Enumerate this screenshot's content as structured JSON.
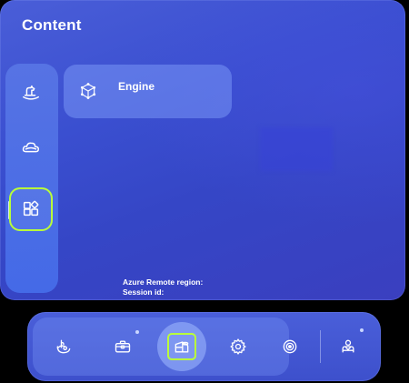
{
  "panel": {
    "title": "Content"
  },
  "rail": {
    "items": [
      {
        "id": "rocking-horse",
        "icon": "rocking-horse-icon",
        "selected": false
      },
      {
        "id": "cloud",
        "icon": "cloud-outline-icon",
        "selected": false
      },
      {
        "id": "app-grid-add",
        "icon": "app-grid-add-icon",
        "selected": true
      }
    ]
  },
  "cards": [
    {
      "label": "Engine",
      "icon": "cube-icon"
    }
  ],
  "info": {
    "region_label": "Azure Remote region:",
    "session_label": "Session id:"
  },
  "toolbar": {
    "items": [
      {
        "id": "mixed-reality",
        "icon": "eye-hand-icon"
      },
      {
        "id": "toolbox",
        "icon": "toolbox-icon",
        "badge": true
      },
      {
        "id": "content",
        "icon": "content-box-icon",
        "active": true
      },
      {
        "id": "settings",
        "icon": "gear-icon"
      },
      {
        "id": "target",
        "icon": "target-icon"
      },
      {
        "id": "assistant",
        "icon": "person-assistant-icon",
        "badge": true
      }
    ]
  },
  "colors": {
    "accent_highlight": "#b9ff3a",
    "panel_blue": "#3a4fd0",
    "text": "#ffffff"
  }
}
